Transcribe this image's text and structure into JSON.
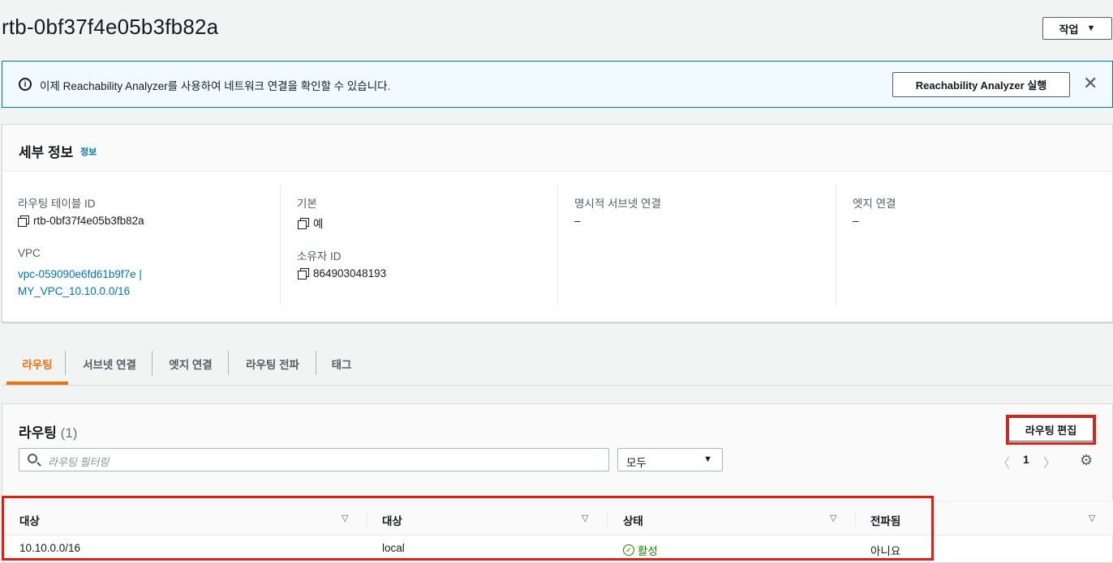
{
  "page": {
    "title": "rtb-0bf37f4e05b3fb82a",
    "actions_label": "작업"
  },
  "flash": {
    "message": "이제 Reachability Analyzer를 사용하여 네트워크 연결을 확인할 수 있습니다.",
    "button_label": "Reachability Analyzer 실행",
    "close_symbol": "✕"
  },
  "details": {
    "title": "세부 정보",
    "info_link": "정보",
    "route_table_id_label": "라우팅 테이블 ID",
    "route_table_id_value": "rtb-0bf37f4e05b3fb82a",
    "vpc_label": "VPC",
    "vpc_value_line1": "vpc-059090e6fd61b9f7e |",
    "vpc_value_line2": "MY_VPC_10.10.0.0/16",
    "main_label": "기본",
    "main_value": "예",
    "owner_label": "소유자 ID",
    "owner_value": "864903048193",
    "explicit_subnet_label": "명시적 서브넷 연결",
    "explicit_subnet_value": "–",
    "edge_label": "엣지 연결",
    "edge_value": "–"
  },
  "tabs": [
    {
      "label": "라우팅",
      "active": true
    },
    {
      "label": "서브넷 연결",
      "active": false
    },
    {
      "label": "엣지 연결",
      "active": false
    },
    {
      "label": "라우팅 전파",
      "active": false
    },
    {
      "label": "태그",
      "active": false
    }
  ],
  "routes": {
    "title": "라우팅",
    "count": "(1)",
    "edit_button": "라우팅 편집",
    "search_placeholder": "라우팅 필터링",
    "filter_select": "모두",
    "page": "1",
    "columns": [
      "대상",
      "대상",
      "상태",
      "전파됨"
    ],
    "rows": [
      {
        "destination": "10.10.0.0/16",
        "target": "local",
        "status": "활성",
        "propagated": "아니요"
      }
    ]
  },
  "colors": {
    "accent": "#ec7211",
    "link": "#0073bb",
    "success": "#1d8102",
    "highlight": "#e01e14"
  }
}
